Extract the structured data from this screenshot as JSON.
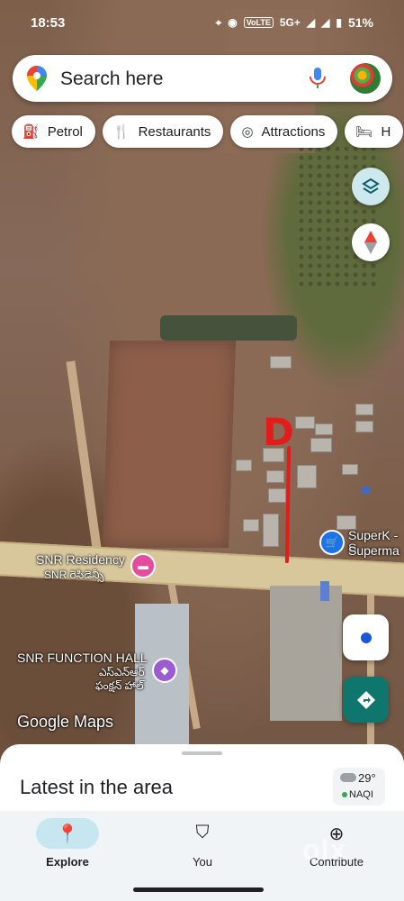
{
  "status_bar": {
    "time": "18:53",
    "network": "5G+",
    "battery": "51%",
    "volte": "VoLTE"
  },
  "search": {
    "placeholder": "Search here"
  },
  "chips": [
    {
      "label": "Petrol",
      "icon": "fuel-icon"
    },
    {
      "label": "Restaurants",
      "icon": "fork-knife-icon"
    },
    {
      "label": "Attractions",
      "icon": "camera-icon"
    },
    {
      "label": "H",
      "icon": "bed-icon"
    }
  ],
  "map_labels": {
    "superk": "SuperK - S",
    "superk2": "Superma",
    "snr_residency": "SNR Residency",
    "snr_residency_te": "SNR రెసిడెన్సీ",
    "snr_hall": "SNR FUNCTION HALL",
    "snr_hall_te1": "ఎస్ఎన్ఆర్",
    "snr_hall_te2": "ఫంక్షన్ హాల్",
    "annotation": "D",
    "brand": "Google Maps"
  },
  "sheet": {
    "title": "Latest in the area",
    "temperature": "29°",
    "aqi_label": "NAQI"
  },
  "nav": {
    "explore": "Explore",
    "you": "You",
    "contribute": "Contribute"
  },
  "watermark": "olx",
  "colors": {
    "accent": "#0f766e",
    "explore_pill": "#c6e7f0",
    "poi_hotel": "#e44d9c",
    "poi_shop": "#1a73e8",
    "poi_hall": "#9c5bd1",
    "annotation": "#e41b1b"
  }
}
